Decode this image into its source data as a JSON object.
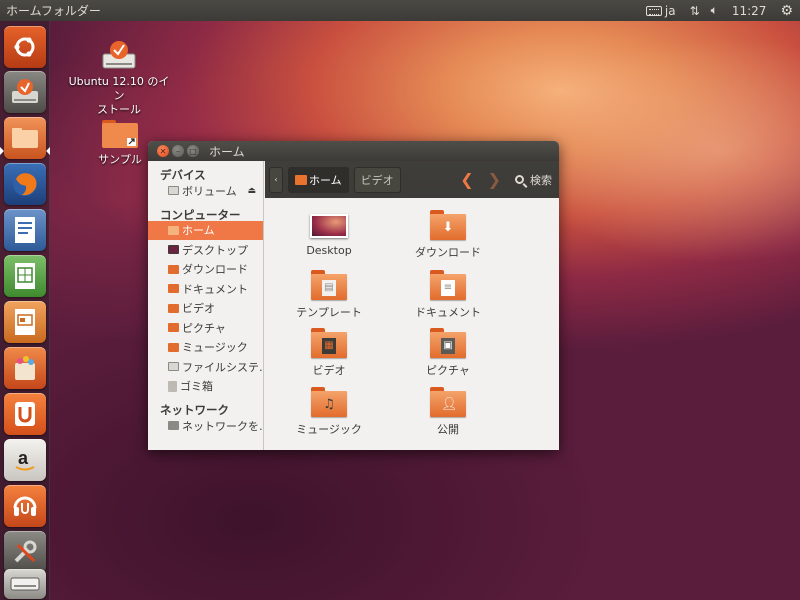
{
  "top_panel": {
    "title": "ホームフォルダー",
    "keyboard": "ja",
    "time": "11:27"
  },
  "launcher": {
    "items": [
      {
        "name": "dash-home",
        "icon": "ubuntu-logo-icon"
      },
      {
        "name": "installer",
        "icon": "installer-icon"
      },
      {
        "name": "files",
        "icon": "folder-icon"
      },
      {
        "name": "firefox",
        "icon": "firefox-icon"
      },
      {
        "name": "writer",
        "icon": "writer-icon"
      },
      {
        "name": "calc",
        "icon": "calc-icon"
      },
      {
        "name": "impress",
        "icon": "impress-icon"
      },
      {
        "name": "software-center",
        "icon": "software-bag-icon"
      },
      {
        "name": "ubuntu-one",
        "icon": "ubuntu-one-icon"
      },
      {
        "name": "amazon",
        "icon": "amazon-icon"
      },
      {
        "name": "ubuntu-one-music",
        "icon": "music-store-icon"
      },
      {
        "name": "system-settings",
        "icon": "settings-icon"
      },
      {
        "name": "disk",
        "icon": "drive-icon"
      }
    ]
  },
  "desktop": {
    "installer_label_1": "Ubuntu 12.10 のイン",
    "installer_label_2": "ストール",
    "sample_label": "サンプル"
  },
  "window": {
    "title": "ホーム",
    "sidebar": {
      "devices_heading": "デバイス",
      "volume": "ボリューム",
      "computer_heading": "コンピューター",
      "places": [
        "ホーム",
        "デスクトップ",
        "ダウンロード",
        "ドキュメント",
        "ビデオ",
        "ピクチャ",
        "ミュージック",
        "ファイルシステ…",
        "ゴミ箱"
      ],
      "network_heading": "ネットワーク",
      "network_item": "ネットワークを…"
    },
    "toolbar": {
      "back": "‹",
      "crumb_home": "ホーム",
      "crumb_video": "ビデオ",
      "prev": "❮",
      "next": "❯",
      "search": "検索"
    },
    "files": [
      {
        "label": "Desktop"
      },
      {
        "label": "ダウンロード"
      },
      {
        "label": "テンプレート"
      },
      {
        "label": "ドキュメント"
      },
      {
        "label": "ビデオ"
      },
      {
        "label": "ピクチャ"
      },
      {
        "label": "ミュージック"
      },
      {
        "label": "公開"
      }
    ]
  },
  "colors": {
    "accent": "#f07746",
    "panel": "#3c3b37",
    "folder_orange": "#e26c2d"
  }
}
